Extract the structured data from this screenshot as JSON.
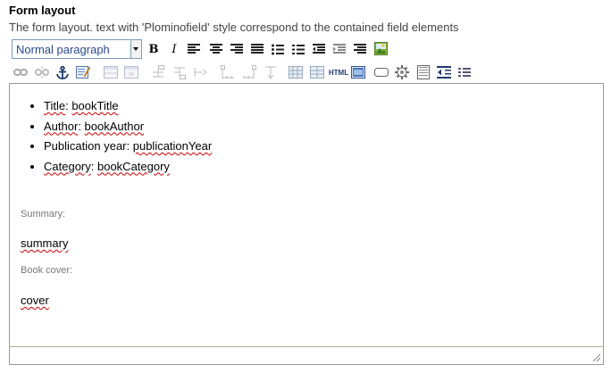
{
  "field": {
    "title": "Form layout",
    "help": "The form layout. text with 'Plominofield' style correspond to the contained field elements"
  },
  "toolbar": {
    "style_select": {
      "value": "Normal paragraph"
    },
    "bold_label": "B",
    "italic_label": "I",
    "html_label": "HTML",
    "icons_row1": [
      "align-left-icon",
      "align-center-icon",
      "align-right-icon",
      "align-justify-icon",
      "bullet-list-icon",
      "numbered-list-icon",
      "outdent-icon",
      "indent-icon",
      "definition-list-icon",
      "image-icon"
    ],
    "icons_row2": [
      "link-icon",
      "unlink-icon",
      "anchor-icon",
      "edit-icon",
      "table-icon",
      "table-props-icon",
      "row-before-icon",
      "row-after-icon",
      "delete-row-icon",
      "col-before-icon",
      "col-after-icon",
      "delete-col-icon",
      "merge-cells-icon",
      "split-cells-icon",
      "html-source-icon",
      "document-icon",
      "input-icon",
      "gear-icon",
      "form-icon",
      "insert-field-icon",
      "list-icon"
    ]
  },
  "editor": {
    "bullets": [
      {
        "label": "Title",
        "value": "bookTitle"
      },
      {
        "label": "Author",
        "value": "bookAuthor"
      },
      {
        "label": "Publication year",
        "value": "publicationYear"
      },
      {
        "label": "Category",
        "value": "bookCategory"
      }
    ],
    "summary_label": "Summary:",
    "summary_value": "summary",
    "cover_label": "Book cover:",
    "cover_value": "cover"
  },
  "colors": {
    "link": "#2a4b8d",
    "spellcheck": "#cc0000",
    "border": "#999999"
  }
}
